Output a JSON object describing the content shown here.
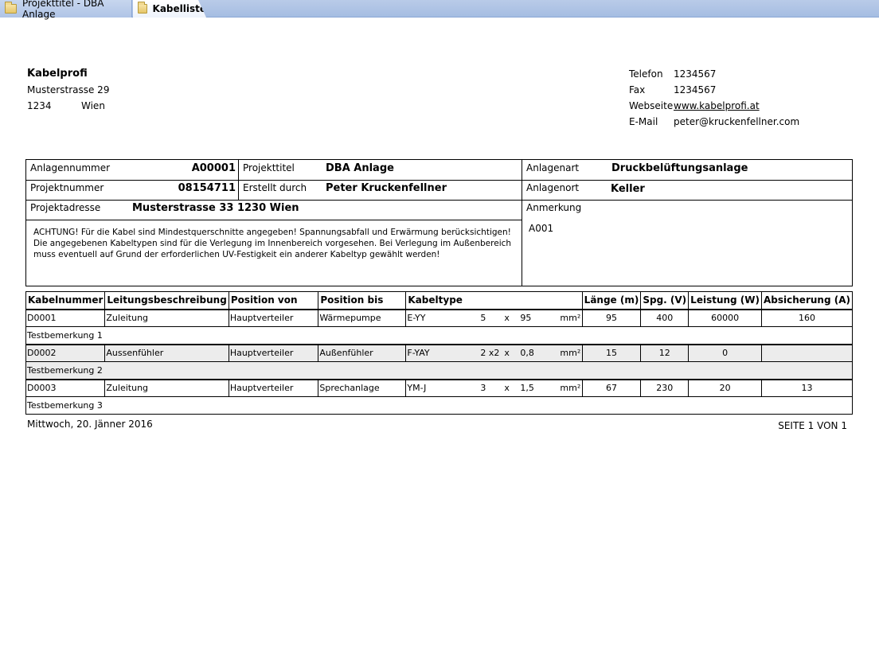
{
  "tabs": [
    {
      "label": "Projekttitel - DBA Anlage",
      "icon": "folder-icon"
    },
    {
      "label": "Kabelliste",
      "icon": "folder-icon"
    }
  ],
  "company": {
    "name": "Kabelprofi",
    "street": "Musterstrasse 29",
    "zip": "1234",
    "city": "Wien"
  },
  "contact": {
    "phone_label": "Telefon",
    "phone": "1234567",
    "fax_label": "Fax",
    "fax": "1234567",
    "web_label": "Webseite",
    "web": "www.kabelprofi.at",
    "mail_label": "E-Mail",
    "mail": "peter@kruckenfellner.com"
  },
  "project": {
    "anlagennummer_label": "Anlagennummer",
    "anlagennummer": "A00001",
    "projekttitel_label": "Projekttitel",
    "projekttitel": "DBA Anlage",
    "anlagenart_label": "Anlagenart",
    "anlagenart": "Druckbelüftungsanlage",
    "projektnummer_label": "Projektnummer",
    "projektnummer": "08154711",
    "erstellt_label": "Erstellt durch",
    "erstellt": "Peter Kruckenfellner",
    "anlagenort_label": "Anlagenort",
    "anlagenort": "Keller",
    "adresse_label": "Projektadresse",
    "adresse": "Musterstrasse 33 1230 Wien",
    "anmerkung_label": "Anmerkung",
    "anmerkung": "A001",
    "notice": "ACHTUNG! Für die Kabel sind Mindestquerschnitte angegeben! Spannungsabfall und Erwärmung berücksichtigen! Die angegebenen Kabeltypen sind für die Verlegung im Innenbereich vorgesehen. Bei Verlegung im Außenbereich muss eventuell auf Grund der erforderlichen UV-Festigkeit ein anderer Kabeltyp gewählt werden!"
  },
  "table": {
    "headers": [
      "Kabelnummer",
      "Leitungsbeschreibung",
      "Position von",
      "Position bis",
      "Kabeltype",
      "Länge (m)",
      "Spg. (V)",
      "Leistung (W)",
      "Absicherung (A)"
    ],
    "rows": [
      {
        "nr": "D0001",
        "desc": "Zuleitung",
        "von": "Hauptverteiler",
        "bis": "Wärmepumpe",
        "type": "E-YY",
        "cores": "5",
        "x": "x",
        "section": "95",
        "unit": "mm²",
        "len": "95",
        "volt": "400",
        "power": "60000",
        "fuse": "160",
        "remark": "Testbemerkung 1"
      },
      {
        "nr": "D0002",
        "desc": "Aussenfühler",
        "von": "Hauptverteiler",
        "bis": "Außenfühler",
        "type": "F-YAY",
        "cores": "2 x2",
        "x": "x",
        "section": "0,8",
        "unit": "mm²",
        "len": "15",
        "volt": "12",
        "power": "0",
        "fuse": "",
        "remark": "Testbemerkung 2"
      },
      {
        "nr": "D0003",
        "desc": "Zuleitung",
        "von": "Hauptverteiler",
        "bis": "Sprechanlage",
        "type": "YM-J",
        "cores": "3",
        "x": "x",
        "section": "1,5",
        "unit": "mm²",
        "len": "67",
        "volt": "230",
        "power": "20",
        "fuse": "13",
        "remark": "Testbemerkung 3"
      }
    ]
  },
  "footer": {
    "date": "Mittwoch, 20. Jänner 2016",
    "page": "SEITE 1 VON 1"
  }
}
